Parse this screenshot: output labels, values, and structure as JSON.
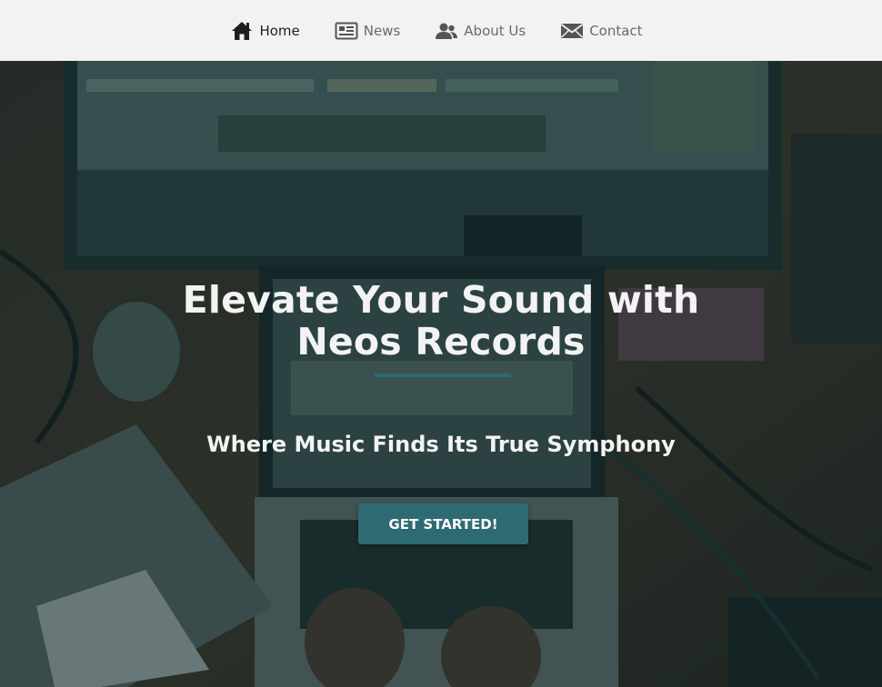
{
  "nav": {
    "items": [
      {
        "label": "Home",
        "icon": "home-icon",
        "active": true
      },
      {
        "label": "News",
        "icon": "newspaper-icon",
        "active": false
      },
      {
        "label": "About Us",
        "icon": "users-icon",
        "active": false
      },
      {
        "label": "Contact",
        "icon": "envelope-icon",
        "active": false
      }
    ]
  },
  "hero": {
    "title_line1": "Elevate Your Sound with",
    "title_line2": "Neos Records",
    "subtitle": "Where Music Finds Its True Symphony",
    "cta_label": "GET STARTED!"
  },
  "colors": {
    "nav_background": "#f2f2f2",
    "accent": "#2e6a73",
    "overlay": "#0a2224",
    "hero_text": "#f3f3f3"
  }
}
